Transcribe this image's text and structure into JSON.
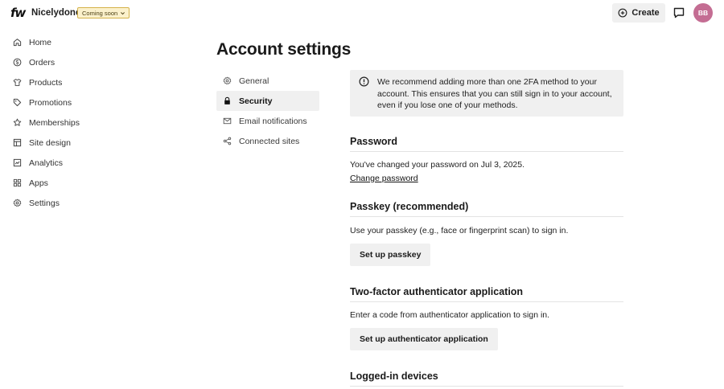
{
  "header": {
    "logo": "fw",
    "site_name": "Nicelydone",
    "badge": "Coming soon",
    "create_label": "Create",
    "avatar_initials": "BB"
  },
  "sidebar": {
    "items": [
      {
        "label": "Home",
        "icon": "home-icon"
      },
      {
        "label": "Orders",
        "icon": "orders-icon"
      },
      {
        "label": "Products",
        "icon": "products-icon"
      },
      {
        "label": "Promotions",
        "icon": "tag-icon"
      },
      {
        "label": "Memberships",
        "icon": "star-icon"
      },
      {
        "label": "Site design",
        "icon": "layout-icon"
      },
      {
        "label": "Analytics",
        "icon": "chart-icon"
      },
      {
        "label": "Apps",
        "icon": "apps-icon"
      },
      {
        "label": "Settings",
        "icon": "gear-icon"
      }
    ]
  },
  "page": {
    "title": "Account settings"
  },
  "subnav": {
    "items": [
      {
        "label": "General",
        "icon": "gear-icon",
        "active": false
      },
      {
        "label": "Security",
        "icon": "lock-icon",
        "active": true
      },
      {
        "label": "Email notifications",
        "icon": "mail-icon",
        "active": false
      },
      {
        "label": "Connected sites",
        "icon": "share-icon",
        "active": false
      }
    ]
  },
  "content": {
    "notice": "We recommend adding more than one 2FA method to your account. This ensures that you can still sign in to your account, even if you lose one of your methods.",
    "password": {
      "title": "Password",
      "text": "You've changed your password on Jul 3, 2025.",
      "link": "Change password"
    },
    "passkey": {
      "title": "Passkey (recommended)",
      "text": "Use your passkey (e.g., face or fingerprint scan) to sign in.",
      "button": "Set up passkey"
    },
    "two_factor": {
      "title": "Two-factor authenticator application",
      "text": "Enter a code from authenticator application to sign in.",
      "button": "Set up authenticator application"
    },
    "devices": {
      "title": "Logged-in devices"
    }
  }
}
